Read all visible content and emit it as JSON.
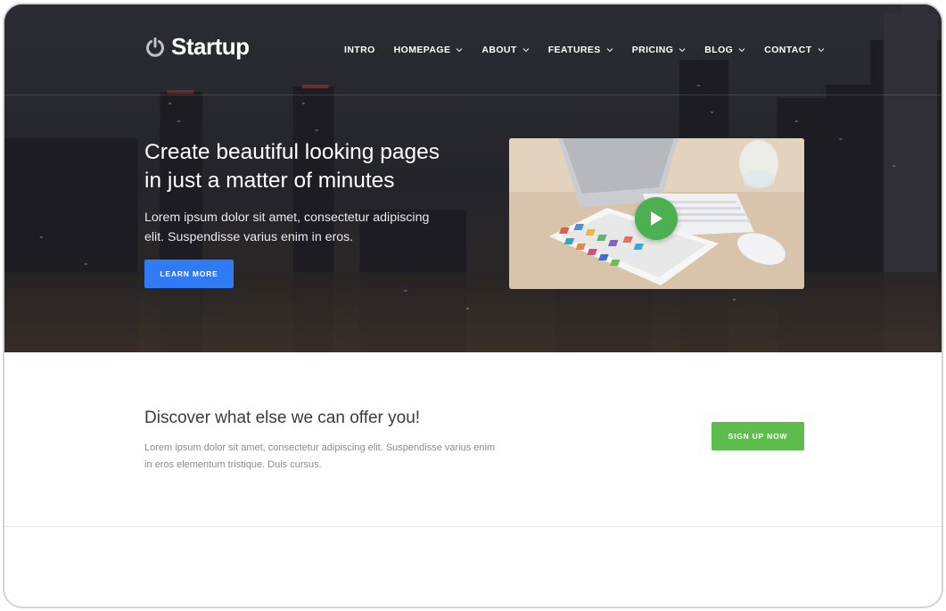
{
  "brand": {
    "name": "Startup",
    "icon": "power-icon"
  },
  "nav": {
    "items": [
      {
        "label": "INTRO",
        "dropdown": false
      },
      {
        "label": "HOMEPAGE",
        "dropdown": true
      },
      {
        "label": "ABOUT",
        "dropdown": true
      },
      {
        "label": "FEATURES",
        "dropdown": true
      },
      {
        "label": "PRICING",
        "dropdown": true
      },
      {
        "label": "BLOG",
        "dropdown": true
      },
      {
        "label": "CONTACT",
        "dropdown": true
      }
    ]
  },
  "hero": {
    "title_line1": "Create beautiful looking pages",
    "title_line2": "in just a matter of minutes",
    "text_line1": "Lorem ipsum dolor sit amet, consectetur adipiscing",
    "text_line2": "elit. Suspendisse varius enim in eros.",
    "button_label": "LEARN MORE",
    "video_icon": "play-icon"
  },
  "cta": {
    "title": "Discover what else we can offer you!",
    "text_line1": "Lorem ipsum dolor sit amet, consectetur adipiscing elit. Suspendisse varius enim",
    "text_line2": "in eros elementum tristique. Duis cursus.",
    "button_label": "SIGN UP NOW"
  },
  "colors": {
    "primary_button": "#2f7bf5",
    "cta_button": "#5cbd4c",
    "play_button": "#4caf50"
  }
}
